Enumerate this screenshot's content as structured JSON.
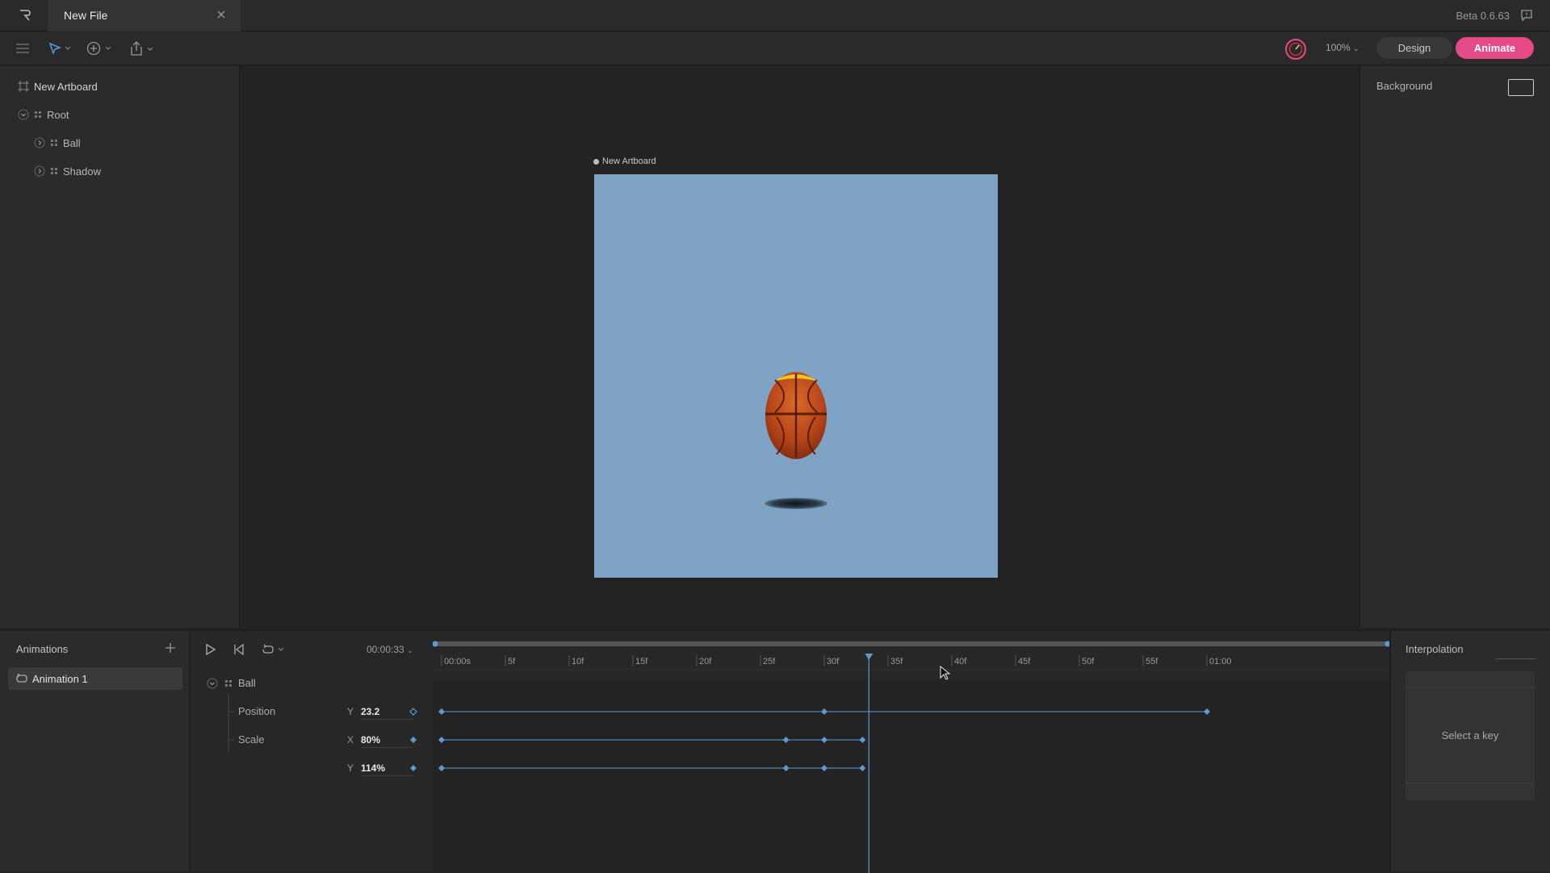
{
  "app": {
    "tab_title": "New File",
    "version": "Beta 0.6.63"
  },
  "toolbar": {
    "zoom": "100%",
    "design_label": "Design",
    "animate_label": "Animate"
  },
  "hierarchy": {
    "artboard": "New Artboard",
    "items": [
      {
        "label": "Root"
      },
      {
        "label": "Ball"
      },
      {
        "label": "Shadow"
      }
    ]
  },
  "stage": {
    "artboard_label": "New Artboard",
    "background_color": "#7ea3c4"
  },
  "inspector": {
    "background_label": "Background"
  },
  "animations": {
    "title": "Animations",
    "items": [
      {
        "label": "Animation 1"
      }
    ]
  },
  "timeline": {
    "current_time": "00:00:33",
    "group": "Ball",
    "properties": [
      {
        "name": "Position",
        "axis": "Y",
        "value": "23.2"
      },
      {
        "name": "Scale",
        "axis": "X",
        "value": "80%"
      },
      {
        "name": "",
        "axis": "Y",
        "value": "114%"
      }
    ],
    "ticks": [
      "00:00s",
      "5f",
      "10f",
      "15f",
      "20f",
      "25f",
      "30f",
      "35f",
      "40f",
      "45f",
      "50f",
      "55f",
      "01:00"
    ],
    "playhead_frame": 33.5
  },
  "interpolation": {
    "title": "Interpolation",
    "hint": "Select a key"
  },
  "colors": {
    "accent": "#e54a86",
    "keyframe": "#5b9bd5",
    "ball": "#b8461a"
  }
}
